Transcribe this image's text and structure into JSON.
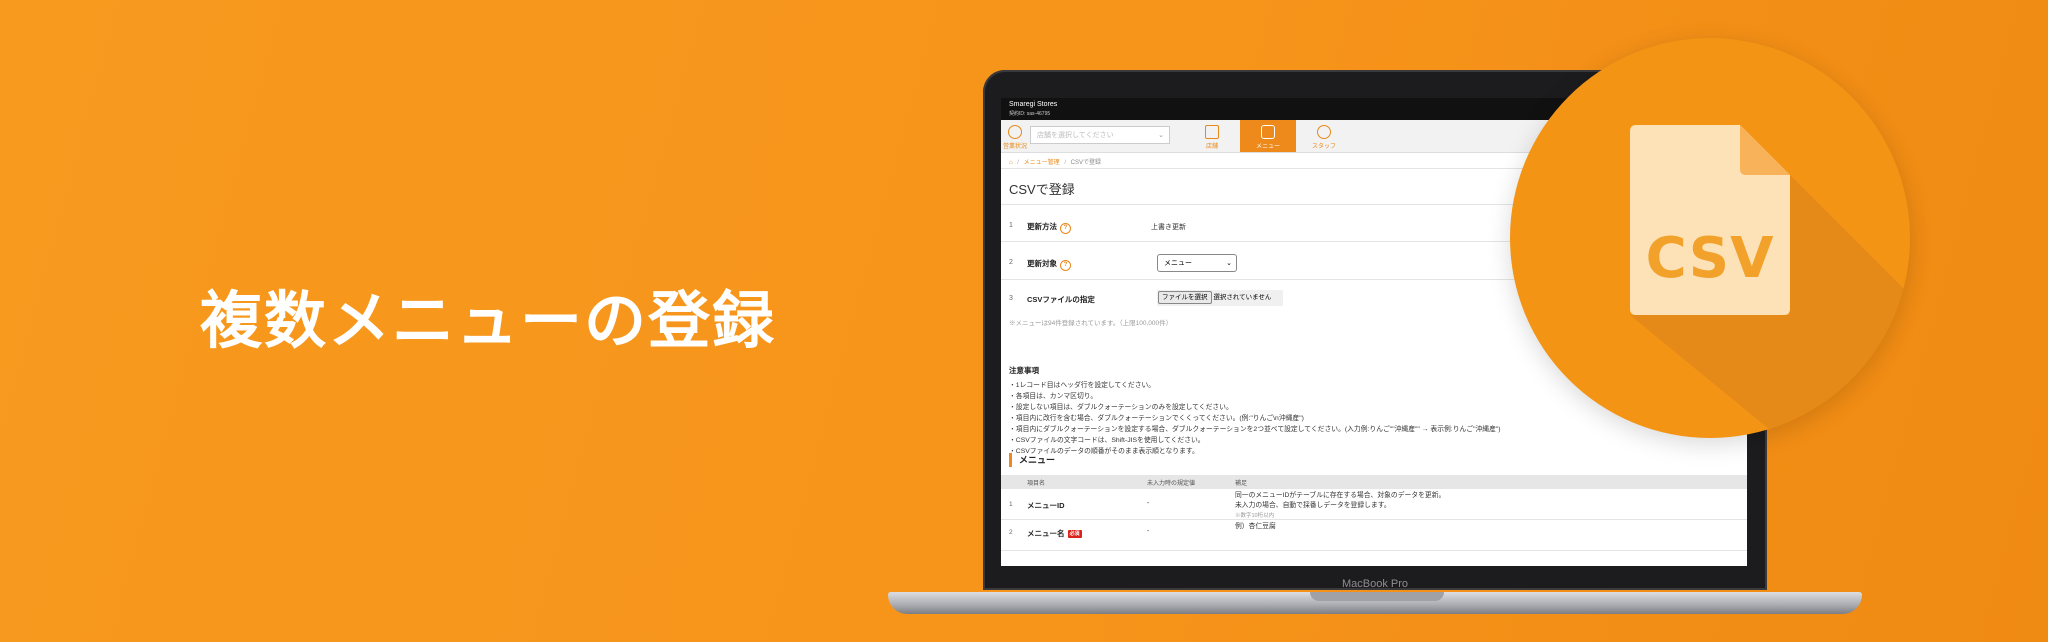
{
  "headline": "複数メニューの登録",
  "laptop_model": "MacBook Pro",
  "badge": {
    "text": "CSV"
  },
  "app": {
    "store_name": "Smaregi Stores",
    "contract_id": "契約ID: sas-46795",
    "nav": {
      "status_label": "営業状況",
      "store_placeholder": "店舗を選択してください",
      "items": [
        {
          "label": "店舗",
          "icon": "store-icon"
        },
        {
          "label": "メニュー",
          "icon": "menu-icon"
        },
        {
          "label": "スタッフ",
          "icon": "staff-icon"
        }
      ]
    },
    "breadcrumb": {
      "home_icon": "home-icon",
      "parent": "メニュー管理",
      "current": "CSVで登録"
    },
    "page_title": "CSVで登録",
    "form": {
      "rows": [
        {
          "num": "1",
          "label": "更新方法",
          "value": "上書き更新"
        },
        {
          "num": "2",
          "label": "更新対象",
          "value": "メニュー"
        },
        {
          "num": "3",
          "label": "CSVファイルの指定",
          "button": "ファイルを選択",
          "status": "選択されていません"
        }
      ],
      "registered_note": "※メニューは94件登録されています。（上限100,000件）"
    },
    "notice": {
      "title": "注意事項",
      "lines": [
        "・1レコード目はヘッダ行を設定してください。",
        "・各項目は、カンマ区切り。",
        "・設定しない項目は、ダブルクォーテーションのみを設定してください。",
        "・項目内に改行を含む場合、ダブルクォーテーションでくくってください。(例:\"りんご\\n沖縄産\")",
        "・項目内にダブルクォーテーションを設定する場合、ダブルクォーテーションを2つ並べて設定してください。(入力例:りんご\"\"沖縄産\"\" → 表示例:りんご\"沖縄産\")",
        "・CSVファイルの文字コードは、Shift-JISを使用してください。",
        "・CSVファイルのデータの順番がそのまま表示順となります。"
      ]
    },
    "menu_section": {
      "title": "メニュー",
      "headers": [
        "項目名",
        "未入力時の規定値",
        "補足"
      ],
      "rows": [
        {
          "num": "1",
          "name": "メニューID",
          "required": "",
          "default": "-",
          "desc1": "同一のメニューIDがテーブルに存在する場合、対象のデータを更新。",
          "desc2": "未入力の場合、自動で採番しデータを登録します。",
          "sub": "※数字10桁以内"
        },
        {
          "num": "2",
          "name": "メニュー名",
          "required": "必須",
          "default": "-",
          "desc1": "例）杏仁豆腐",
          "desc2": "",
          "sub": ""
        }
      ]
    }
  },
  "colors": {
    "accent": "#ee8a1c",
    "background": "#f7941a",
    "badge": "#f39414"
  }
}
